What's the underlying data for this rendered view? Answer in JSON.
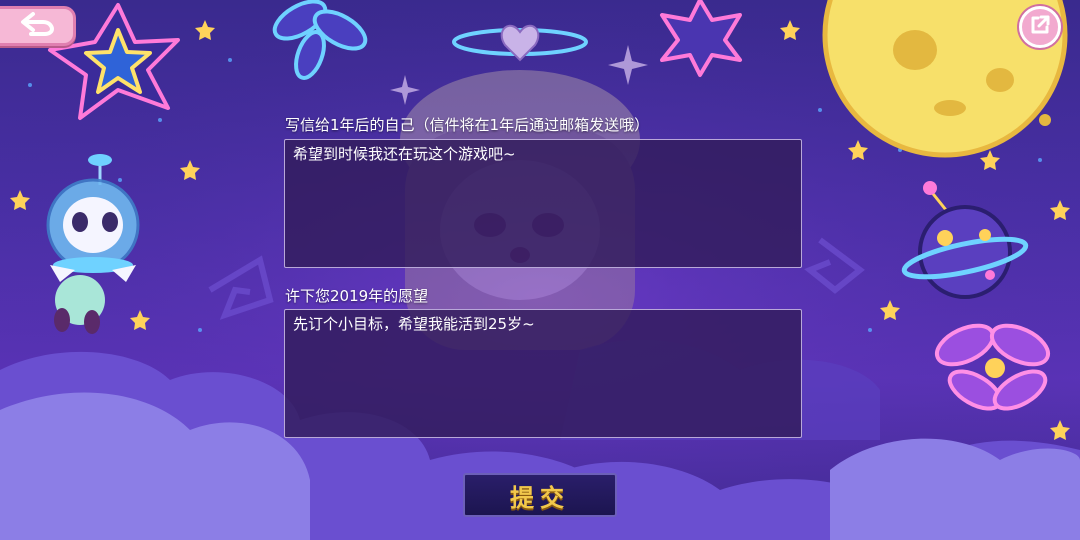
{
  "letter": {
    "label": "写信给1年后的自己（信件将在1年后通过邮箱发送哦）",
    "value": "希望到时候我还在玩这个游戏吧~"
  },
  "wish": {
    "label": "许下您2019年的愿望",
    "value": "先订个小目标，希望我能活到25岁~"
  },
  "submit_label": "提交",
  "icons": {
    "back": "back-arrow-icon",
    "share": "external-link-icon"
  },
  "colors": {
    "background": "#4a2fa6",
    "accent_pink": "#f6b8d6",
    "submit_text": "#f2c84b",
    "moon": "#f7e06a"
  }
}
